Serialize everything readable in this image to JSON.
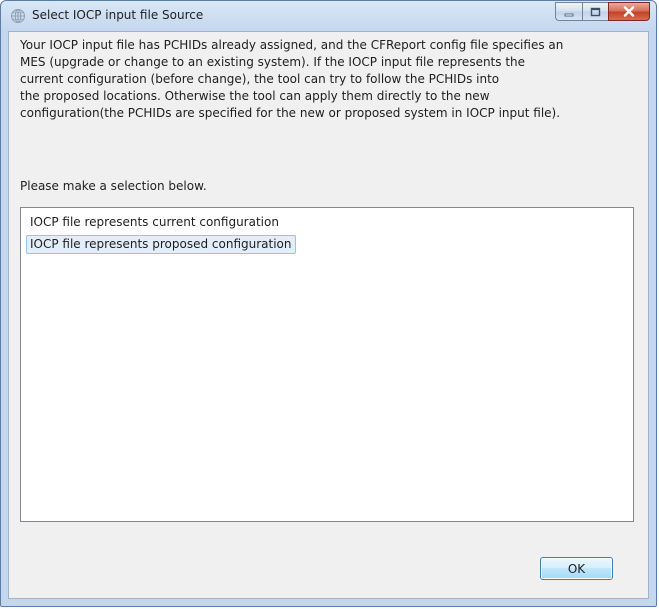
{
  "window": {
    "title": "Select IOCP input file Source",
    "icon": "globe-app-icon",
    "controls": {
      "minimize": "minimize-icon",
      "maximize": "maximize-icon",
      "close": "close-icon"
    }
  },
  "dialog": {
    "message": "Your IOCP input file has PCHIDs already assigned, and the CFReport config file specifies an\nMES (upgrade or change to an existing system). If the IOCP input file represents the\ncurrent configuration (before change), the tool can try to follow the PCHIDs into\nthe proposed locations. Otherwise the tool can apply them directly to the new\nconfiguration(the PCHIDs are specified for the new or proposed system in IOCP input file).",
    "prompt": "Please make a selection below.",
    "options": [
      {
        "label": "IOCP file represents current configuration",
        "selected": false
      },
      {
        "label": "IOCP file represents proposed configuration",
        "selected": true
      }
    ],
    "ok_label": "OK"
  },
  "colors": {
    "selection_fill": "#e3eefb",
    "selection_border": "#9cc1ec",
    "close_button": "#c44329",
    "frame": "#c4d7ee"
  }
}
